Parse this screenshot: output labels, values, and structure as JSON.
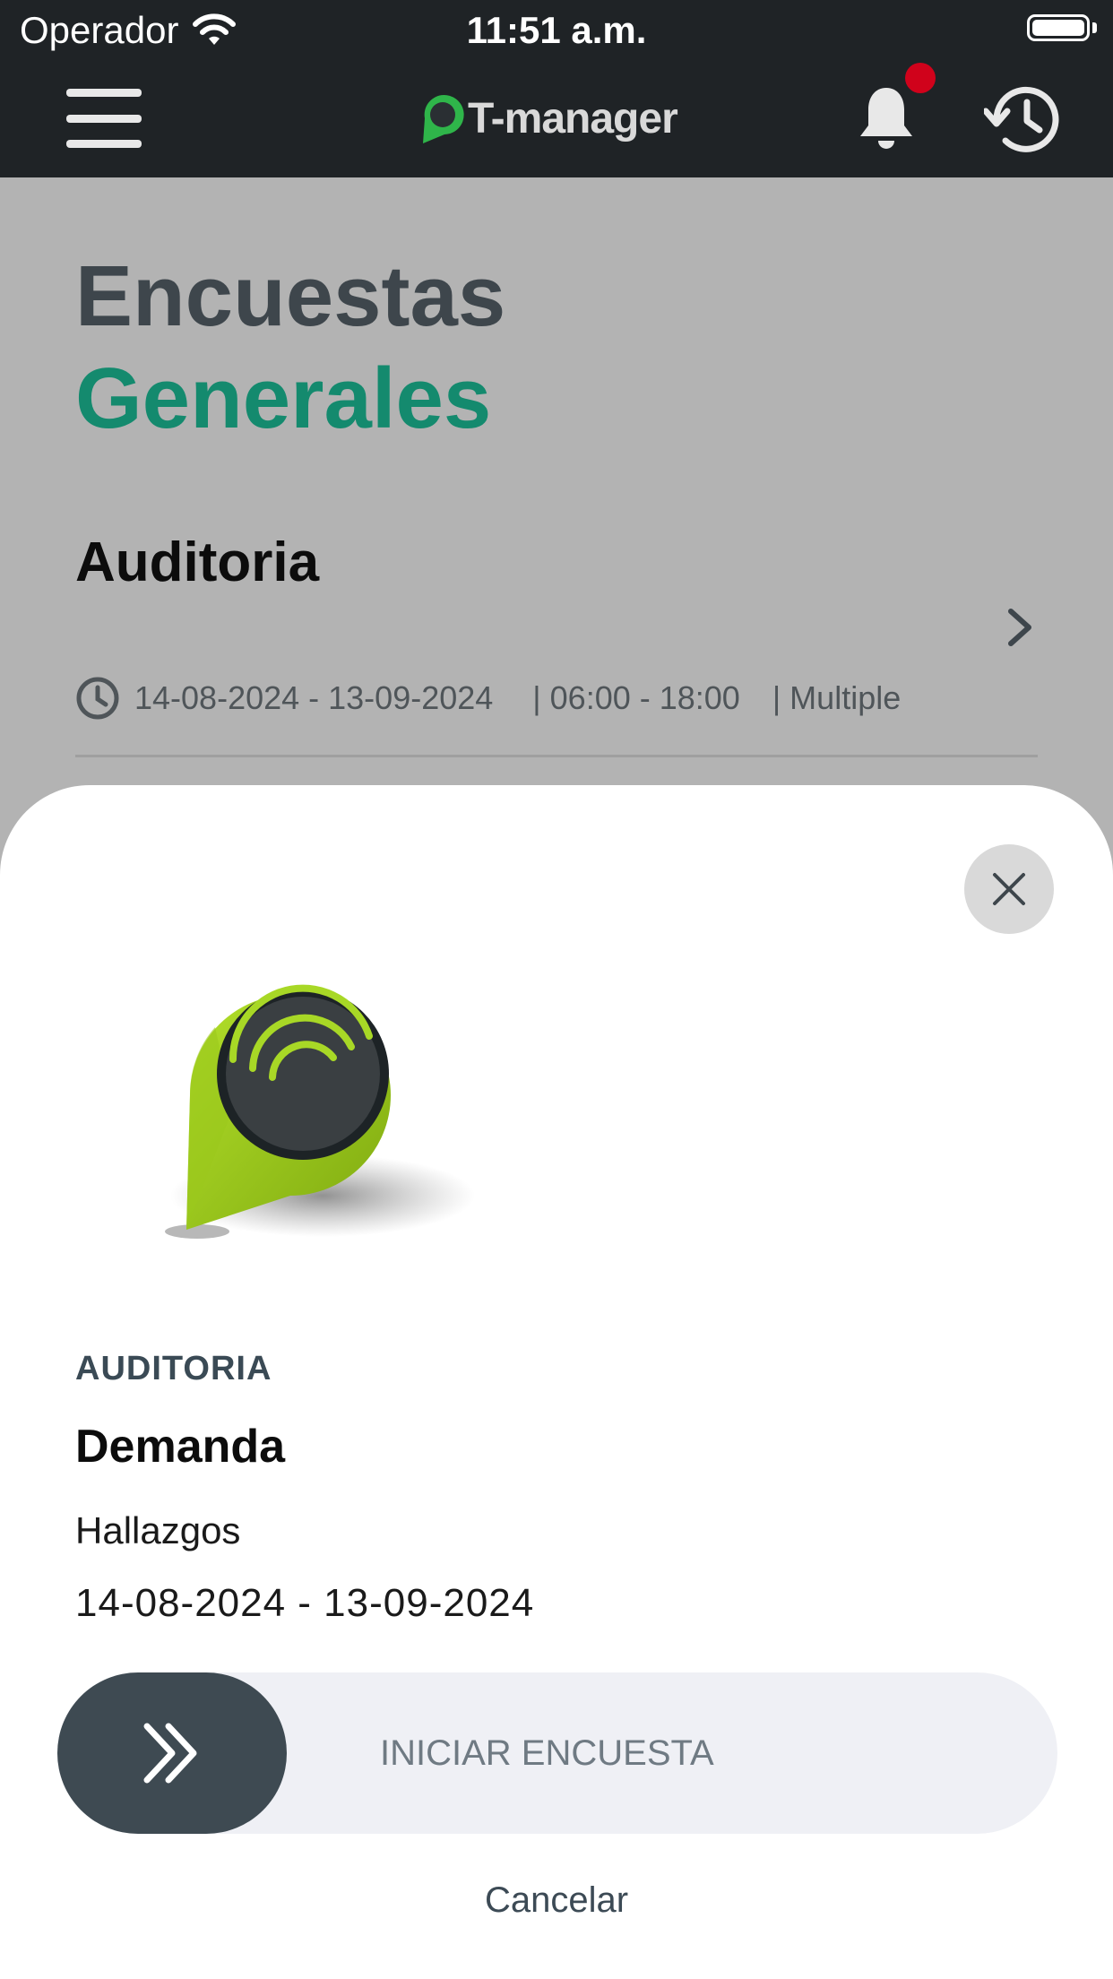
{
  "status_bar": {
    "carrier": "Operador",
    "time": "11:51 a.m."
  },
  "header": {
    "logo_text": "T-manager",
    "icons": [
      "menu-icon",
      "bell-icon",
      "history-icon"
    ],
    "notification_dot_color": "#d0021b"
  },
  "page": {
    "title_line1": "Encuestas",
    "title_line2": "Generales",
    "survey": {
      "name": "Auditoria",
      "date_range": "14-08-2024 - 13-09-2024",
      "time_range": "| 06:00 - 18:00",
      "frequency": "| Multiple"
    }
  },
  "sheet": {
    "category": "AUDITORIA",
    "survey_name": "Demanda",
    "survey_type": "Hallazgos",
    "date_range": "14-08-2024 - 13-09-2024",
    "slider_label": "INICIAR ENCUESTA",
    "cancel_label": "Cancelar"
  },
  "colors": {
    "header_bg": "#1f2326",
    "accent_green": "#148a6e",
    "title_dark": "#3e464c",
    "knob": "#3e4a52",
    "pin_green": "#8ec11a"
  }
}
